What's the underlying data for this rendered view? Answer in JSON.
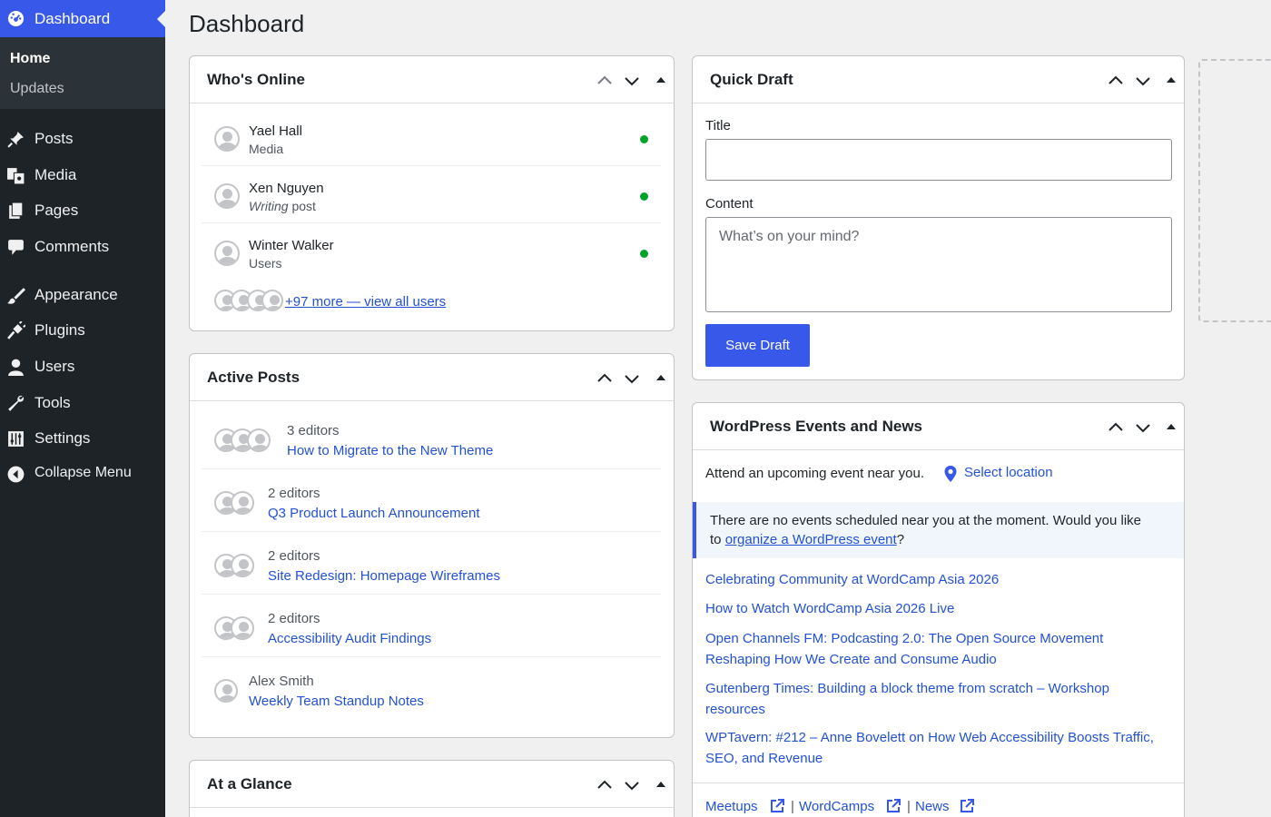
{
  "sidebar": {
    "dashboard_label": "Dashboard",
    "sub_items": [
      {
        "label": "Home"
      },
      {
        "label": "Updates"
      }
    ],
    "items": [
      {
        "label": "Posts",
        "icon": "pin-icon"
      },
      {
        "label": "Media",
        "icon": "media-icon"
      },
      {
        "label": "Pages",
        "icon": "pages-icon"
      },
      {
        "label": "Comments",
        "icon": "comment-icon"
      },
      {
        "label": "Appearance",
        "icon": "brush-icon"
      },
      {
        "label": "Plugins",
        "icon": "plug-icon"
      },
      {
        "label": "Users",
        "icon": "user-icon"
      },
      {
        "label": "Tools",
        "icon": "wrench-icon"
      },
      {
        "label": "Settings",
        "icon": "sliders-icon"
      },
      {
        "label": "Collapse Menu",
        "icon": "collapse-icon"
      }
    ]
  },
  "page_title": "Dashboard",
  "whos_online": {
    "title": "Who's Online",
    "users": [
      {
        "name": "Yael Hall",
        "role": "Media"
      },
      {
        "name": "Xen Nguyen",
        "role_italic": "Writing",
        "role_rest": " post"
      },
      {
        "name": "Winter Walker",
        "role": "Users"
      }
    ],
    "more_link": "+97 more — view all users"
  },
  "active_posts": {
    "title": "Active Posts",
    "posts": [
      {
        "meta": "3 editors",
        "title": "How to Migrate to the New Theme"
      },
      {
        "meta": "2 editors",
        "title": "Q3 Product Launch Announcement"
      },
      {
        "meta": "2 editors",
        "title": "Site Redesign: Homepage Wireframes"
      },
      {
        "meta": "2 editors",
        "title": "Accessibility Audit Findings"
      },
      {
        "meta": "Alex Smith",
        "title": "Weekly Team Standup Notes"
      }
    ]
  },
  "at_a_glance": {
    "title": "At a Glance"
  },
  "quick_draft": {
    "title": "Quick Draft",
    "title_label": "Title",
    "title_value": "",
    "content_label": "Content",
    "content_placeholder": "What’s on your mind?",
    "save_label": "Save Draft"
  },
  "events": {
    "title": "WordPress Events and News",
    "attend_text": "Attend an upcoming event near you.",
    "select_location": "Select location",
    "notice_line1": "There are no events scheduled near you at the moment. Would you like",
    "notice_to": "to ",
    "notice_link": "organize a WordPress event",
    "notice_end": "?",
    "news": [
      "Celebrating Community at WordCamp Asia 2026",
      "How to Watch WordCamp Asia 2026 Live",
      "Open Channels FM: Podcasting 2.0: The Open Source Movement Reshaping How We Create and Consume Audio",
      "Gutenberg Times: Building a block theme from scratch – Workshop resources",
      "WPTavern: #212 – Anne Bovelett on How Web Accessibility Boosts Traffic, SEO, and Revenue"
    ],
    "footer": {
      "meetups": "Meetups",
      "wordcamps": "WordCamps",
      "news": "News",
      "separator": "|"
    }
  },
  "colors": {
    "accent": "#3858e9",
    "sidebar_bg": "#1d2327",
    "link": "#2251d6",
    "online_dot": "#00a32a"
  }
}
